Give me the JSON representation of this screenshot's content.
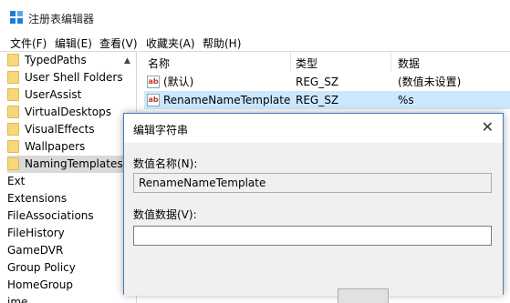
{
  "window": {
    "title": "注册表编辑器"
  },
  "menu": [
    "文件(F)",
    "编辑(E)",
    "查看(V)",
    "收藏夹(A)",
    "帮助(H)"
  ],
  "tree": {
    "folders": [
      "TypedPaths",
      "User Shell Folders",
      "UserAssist",
      "VirtualDesktops",
      "VisualEffects",
      "Wallpapers",
      "NamingTemplates"
    ],
    "keys": [
      "Ext",
      "Extensions",
      "FileAssociations",
      "FileHistory",
      "GameDVR",
      "Group Policy",
      "HomeGroup",
      "ime"
    ]
  },
  "list": {
    "columns": [
      "名称",
      "类型",
      "数据"
    ],
    "rows": [
      {
        "name": "(默认)",
        "type": "REG_SZ",
        "data": "(数值未设置)"
      },
      {
        "name": "RenameNameTemplate",
        "type": "REG_SZ",
        "data": "%s"
      }
    ],
    "icon_text": "ab"
  },
  "dialog": {
    "title": "编辑字符串",
    "close_glyph": "✕",
    "name_label": "数值名称(N):",
    "name_value": "RenameNameTemplate",
    "data_label": "数值数据(V):",
    "data_value": ""
  }
}
